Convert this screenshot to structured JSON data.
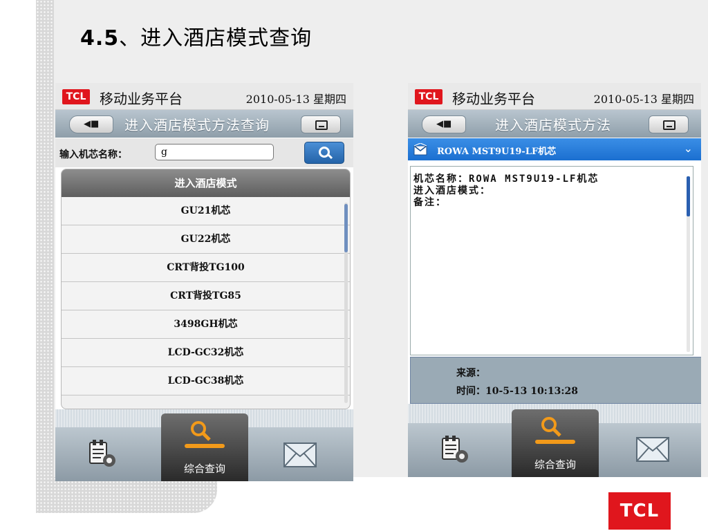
{
  "slide": {
    "number": "4.5",
    "title_text": "、进入酒店模式查询"
  },
  "common": {
    "brand_badge": "TCL",
    "app_name": "移动业务平台",
    "date": "2010-05-13 星期四",
    "tab_label": "综合查询",
    "tab_icons": [
      "settings-icon",
      "search-icon",
      "mail-icon"
    ]
  },
  "left_screen": {
    "nav_title": "进入酒店模式方法查询",
    "search": {
      "label": "输入机芯名称：",
      "value": "g"
    },
    "list_header": "进入酒店模式",
    "items": [
      "GU21机芯",
      "GU22机芯",
      "CRT背投TG100",
      "CRT背投TG85",
      "3498GH机芯",
      "LCD-GC32机芯",
      "LCD-GC38机芯"
    ]
  },
  "right_screen": {
    "nav_title": "进入酒店模式方法",
    "dropdown_text": "ROWA MST9U19-LF机芯",
    "details": {
      "chip_name": "机芯名称：ROWA MST9U19-LF机芯",
      "hotel_mode": "进入酒店模式：",
      "remarks": "备注："
    },
    "source_label": "来源：",
    "time_text": "时间：10-5-13 10:13:28"
  },
  "footer_logo": "TCL",
  "colors": {
    "brand_red": "#e0161d",
    "accent_blue": "#1b6fd0",
    "nav_gray": "#8e9ea9"
  }
}
